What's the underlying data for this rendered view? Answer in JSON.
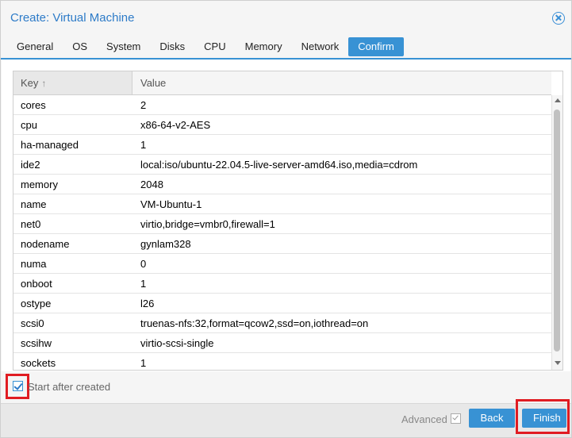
{
  "window": {
    "title": "Create: Virtual Machine"
  },
  "tabs": [
    {
      "label": "General"
    },
    {
      "label": "OS"
    },
    {
      "label": "System"
    },
    {
      "label": "Disks"
    },
    {
      "label": "CPU"
    },
    {
      "label": "Memory"
    },
    {
      "label": "Network"
    },
    {
      "label": "Confirm",
      "active": true
    }
  ],
  "grid": {
    "columns": {
      "key": "Key",
      "value": "Value",
      "sort_indicator": "↑"
    },
    "rows": [
      {
        "key": "cores",
        "value": "2"
      },
      {
        "key": "cpu",
        "value": "x86-64-v2-AES"
      },
      {
        "key": "ha-managed",
        "value": "1"
      },
      {
        "key": "ide2",
        "value": "local:iso/ubuntu-22.04.5-live-server-amd64.iso,media=cdrom"
      },
      {
        "key": "memory",
        "value": "2048"
      },
      {
        "key": "name",
        "value": "VM-Ubuntu-1"
      },
      {
        "key": "net0",
        "value": "virtio,bridge=vmbr0,firewall=1"
      },
      {
        "key": "nodename",
        "value": "gynlam328"
      },
      {
        "key": "numa",
        "value": "0"
      },
      {
        "key": "onboot",
        "value": "1"
      },
      {
        "key": "ostype",
        "value": "l26"
      },
      {
        "key": "scsi0",
        "value": "truenas-nfs:32,format=qcow2,ssd=on,iothread=on"
      },
      {
        "key": "scsihw",
        "value": "virtio-scsi-single"
      },
      {
        "key": "sockets",
        "value": "1"
      }
    ]
  },
  "options": {
    "start_after_created": {
      "label": "Start after created",
      "checked": true
    }
  },
  "footer": {
    "advanced_label": "Advanced",
    "advanced_checked": true,
    "back_label": "Back",
    "finish_label": "Finish"
  },
  "colors": {
    "accent": "#3892d4",
    "title": "#2d7bc8",
    "highlight": "#e01c22"
  }
}
